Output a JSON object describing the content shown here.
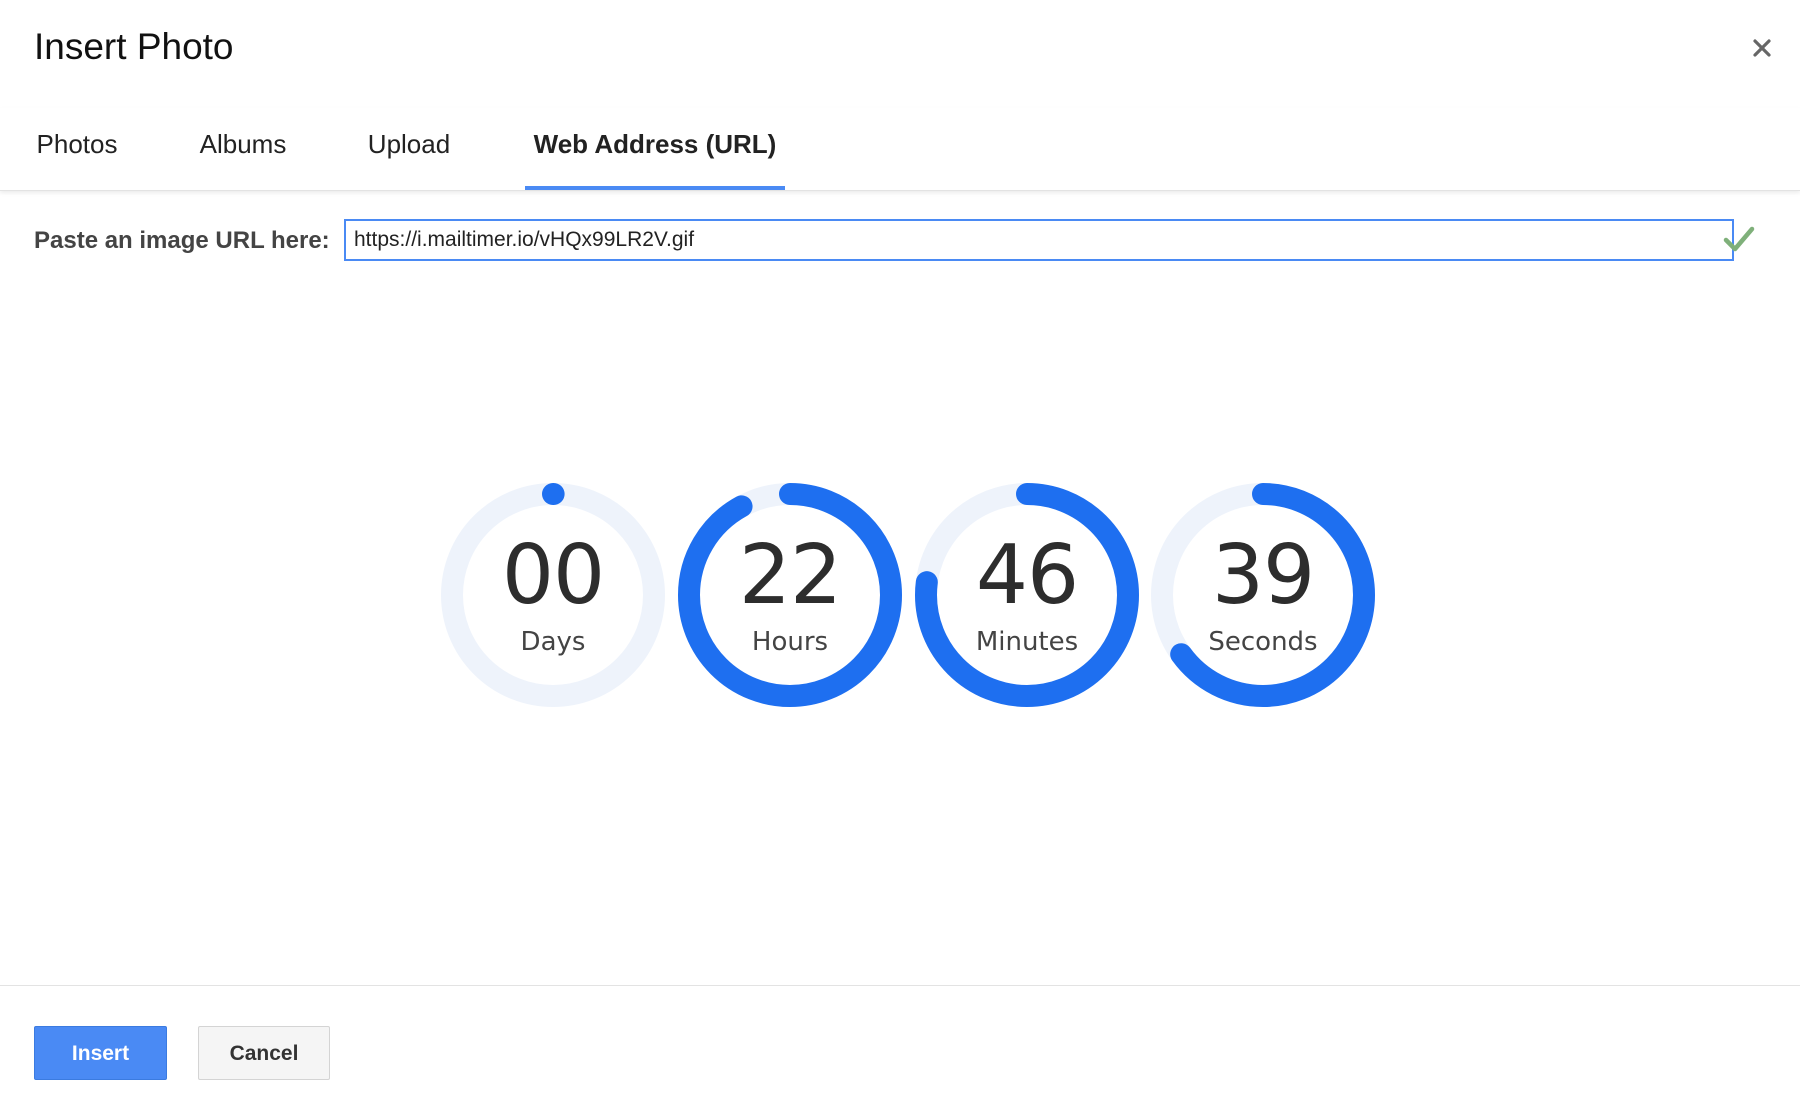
{
  "dialog": {
    "title": "Insert Photo",
    "close_icon": "close-icon"
  },
  "tabs": [
    {
      "label": "Photos",
      "active": false
    },
    {
      "label": "Albums",
      "active": false
    },
    {
      "label": "Upload",
      "active": false
    },
    {
      "label": "Web Address (URL)",
      "active": true
    }
  ],
  "url_section": {
    "label": "Paste an image URL here:",
    "value": "https://i.mailtimer.io/vHQx99LR2V.gif",
    "valid_icon": "checkmark-icon"
  },
  "countdown": [
    {
      "value": "00",
      "label": "Days",
      "progress": 0.0
    },
    {
      "value": "22",
      "label": "Hours",
      "progress": 0.92
    },
    {
      "value": "46",
      "label": "Minutes",
      "progress": 0.77
    },
    {
      "value": "39",
      "label": "Seconds",
      "progress": 0.65
    }
  ],
  "footer": {
    "insert_label": "Insert",
    "cancel_label": "Cancel"
  },
  "colors": {
    "accent": "#4a8af4",
    "ring_fill": "#1e6ff0",
    "ring_track": "#eef3fb",
    "check": "#7fb07a"
  }
}
